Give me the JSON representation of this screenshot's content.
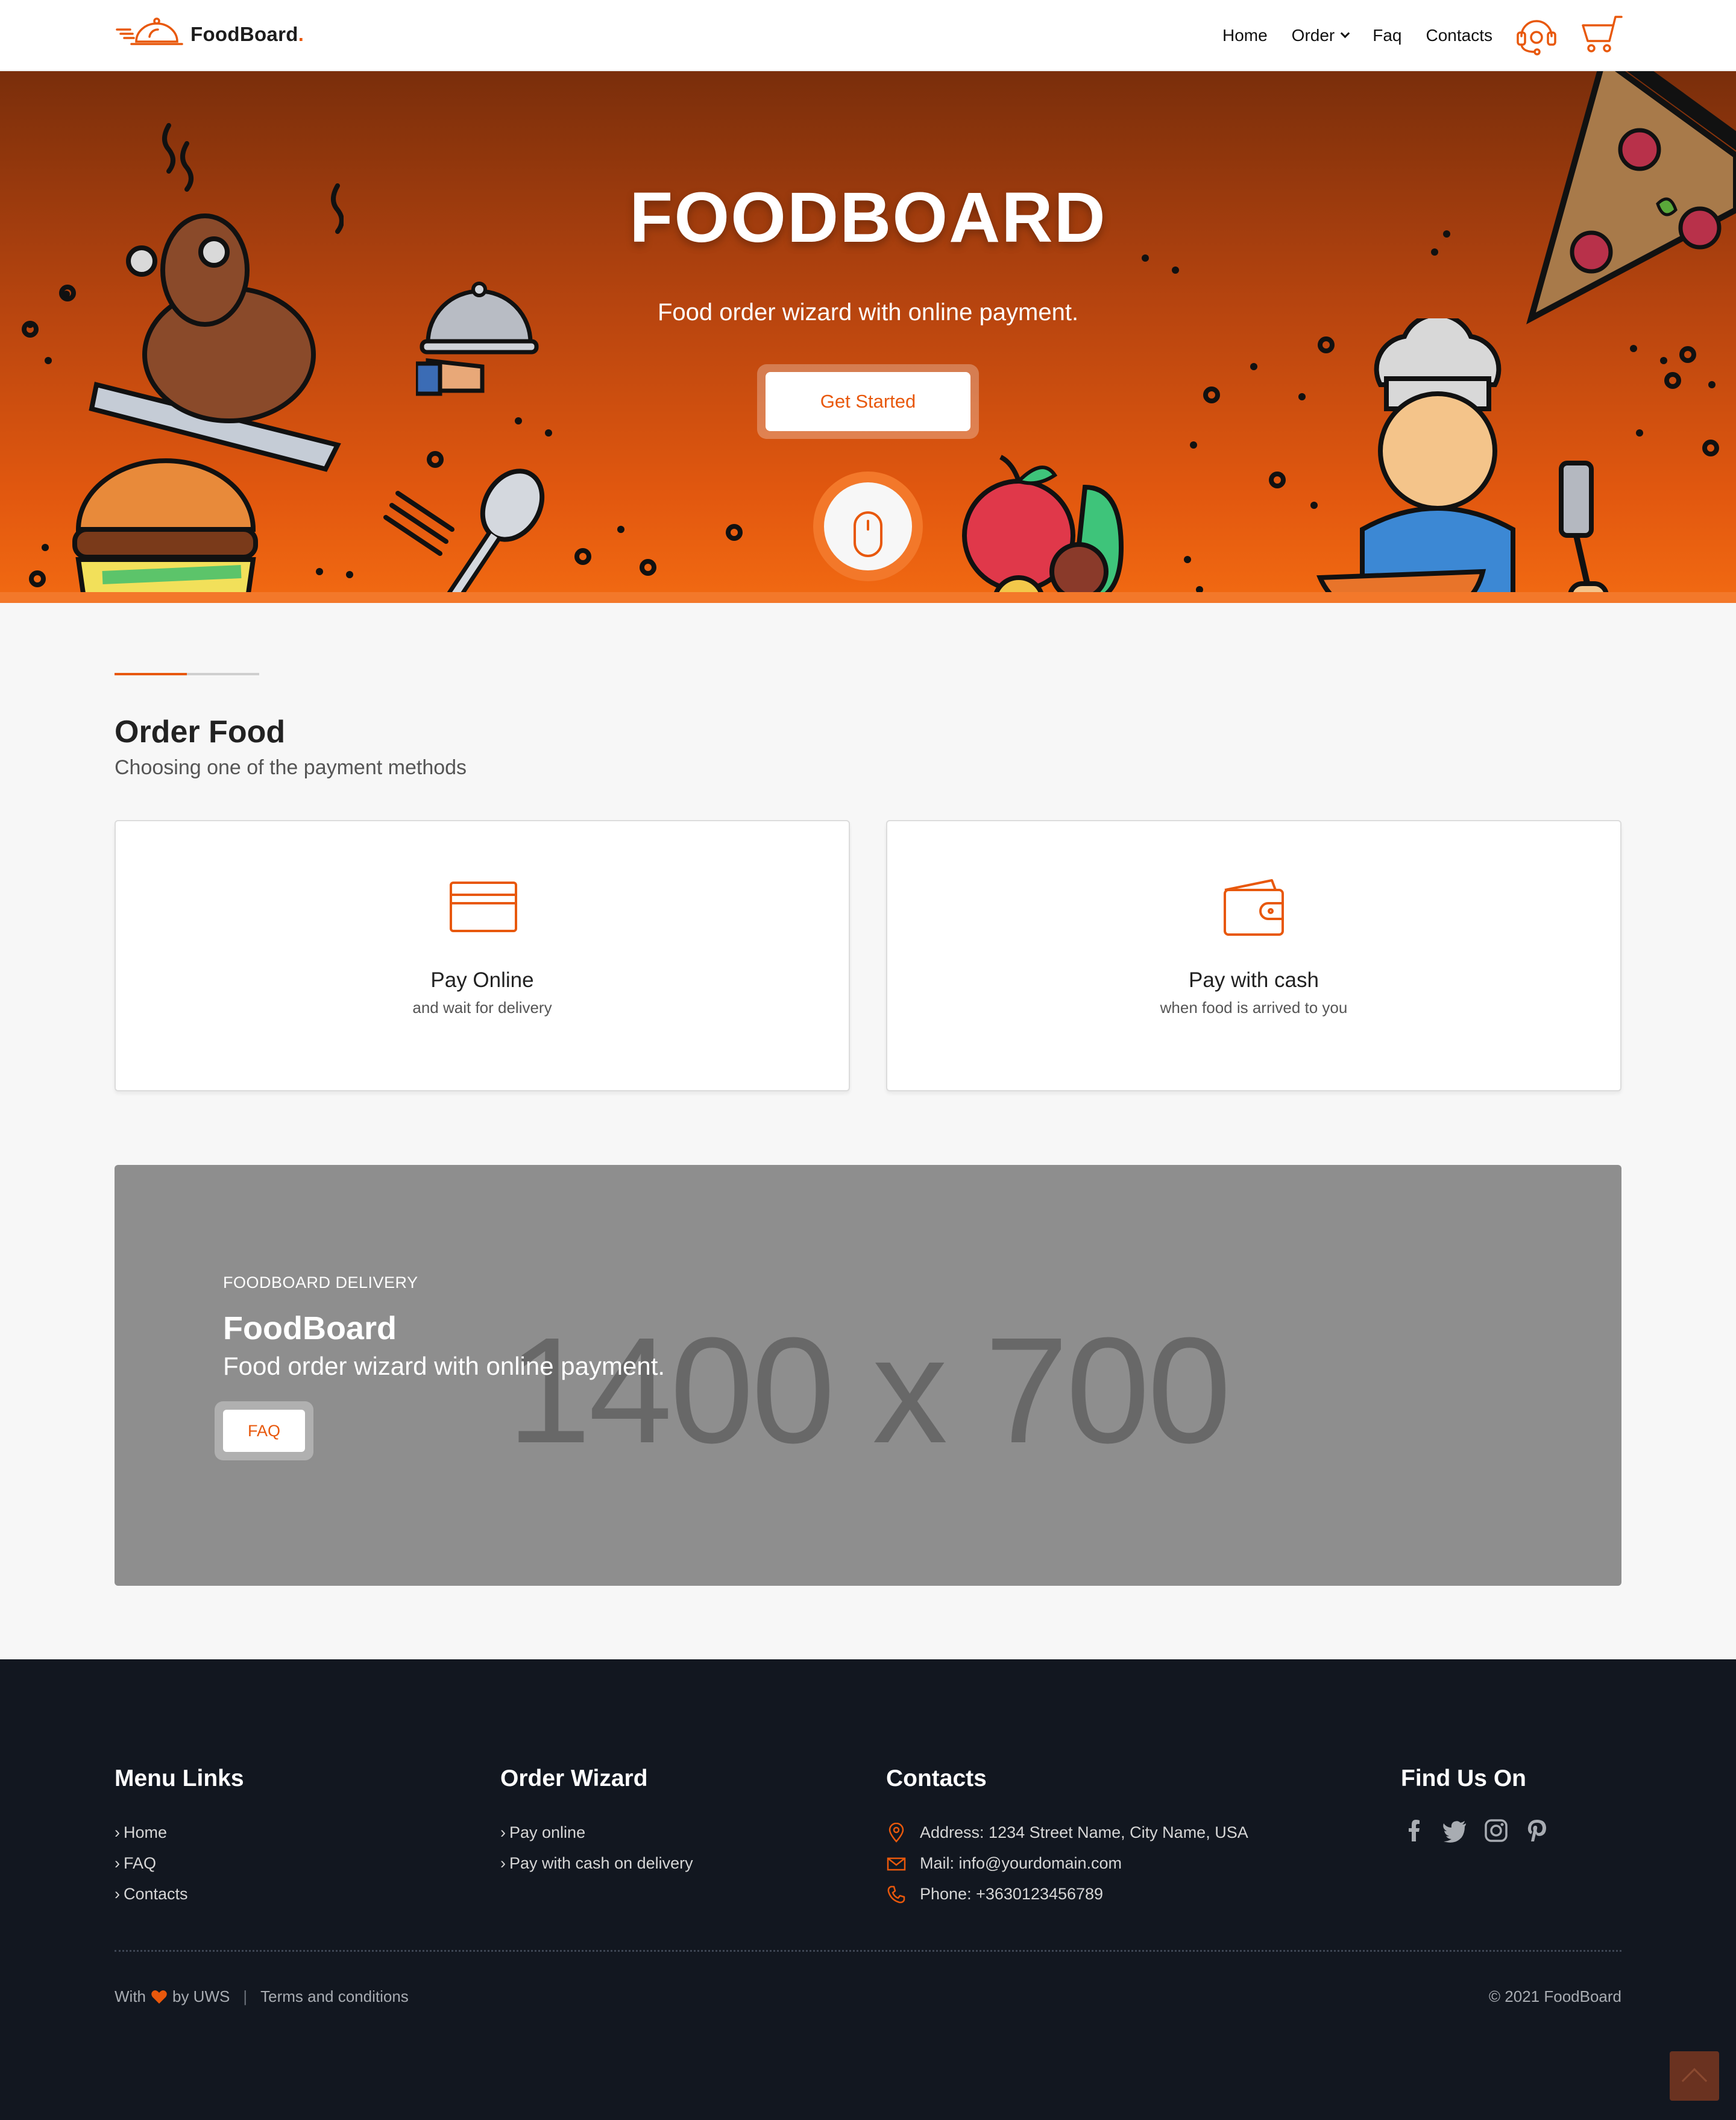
{
  "colors": {
    "accent": "#e8580c",
    "footer_bg": "#121720",
    "hero_top": "#7a2e0b",
    "hero_bottom": "#f26a12"
  },
  "header": {
    "brand": "FoodBoard",
    "brand_dot": ".",
    "nav": {
      "home": "Home",
      "order": "Order",
      "faq": "Faq",
      "contacts": "Contacts"
    },
    "icons": {
      "support": "headset-icon",
      "cart": "cart-icon",
      "logo": "cloche-icon",
      "order_dropdown": "chevron-down-icon"
    }
  },
  "hero": {
    "title": "FOODBOARD",
    "subtitle": "Food order wizard with online payment.",
    "cta": "Get Started",
    "scroll_icon": "mouse-icon"
  },
  "order": {
    "title": "Order Food",
    "subtitle": "Choosing one of the payment methods",
    "cards": [
      {
        "icon": "credit-card-icon",
        "title": "Pay Online",
        "subtitle": "and wait for delivery"
      },
      {
        "icon": "wallet-icon",
        "title": "Pay with cash",
        "subtitle": "when food is arrived to you"
      }
    ]
  },
  "promo": {
    "placeholder": "1400 x 700",
    "kicker": "FOODBOARD DELIVERY",
    "title": "FoodBoard",
    "subtitle": "Food order wizard with online payment.",
    "button": "FAQ"
  },
  "footer": {
    "menu": {
      "heading": "Menu Links",
      "links": [
        "Home",
        "FAQ",
        "Contacts"
      ]
    },
    "wizard": {
      "heading": "Order Wizard",
      "links": [
        "Pay online",
        "Pay with cash on delivery"
      ]
    },
    "contacts": {
      "heading": "Contacts",
      "address": "Address: 1234 Street Name, City Name, USA",
      "mail": "Mail: info@yourdomain.com",
      "phone": "Phone: +3630123456789"
    },
    "social": {
      "heading": "Find Us On",
      "icons": [
        "facebook-icon",
        "twitter-icon",
        "instagram-icon",
        "pinterest-icon"
      ]
    },
    "bottom": {
      "with": "With",
      "by": "by UWS",
      "separator": "|",
      "terms": "Terms and conditions",
      "copyright": "© 2021 FoodBoard"
    }
  }
}
